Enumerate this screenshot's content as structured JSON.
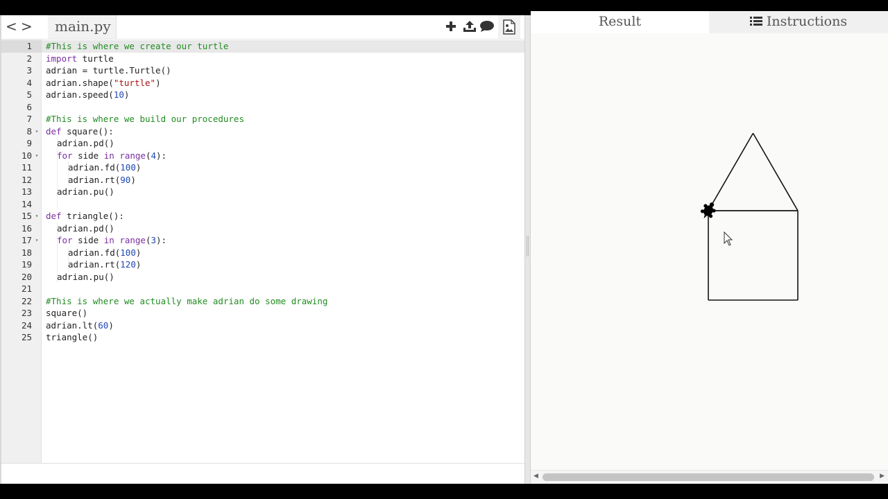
{
  "editor": {
    "nav_prev": "<",
    "nav_next": ">",
    "file_tab": "main.py",
    "toolbar": {
      "icons": [
        "plus-icon",
        "upload-icon",
        "comment-icon",
        "image-file-icon"
      ]
    },
    "lines": [
      {
        "n": "1",
        "fold": "",
        "indent": 0,
        "tokens": [
          {
            "t": "#This is where we create our turtle",
            "c": "com"
          }
        ]
      },
      {
        "n": "2",
        "fold": "",
        "indent": 0,
        "tokens": [
          {
            "t": "import",
            "c": "kw"
          },
          {
            "t": " turtle",
            "c": ""
          }
        ]
      },
      {
        "n": "3",
        "fold": "",
        "indent": 0,
        "tokens": [
          {
            "t": "adrian = turtle.Turtle()",
            "c": ""
          }
        ]
      },
      {
        "n": "4",
        "fold": "",
        "indent": 0,
        "tokens": [
          {
            "t": "adrian.shape(",
            "c": ""
          },
          {
            "t": "\"turtle\"",
            "c": "str"
          },
          {
            "t": ")",
            "c": ""
          }
        ]
      },
      {
        "n": "5",
        "fold": "",
        "indent": 0,
        "tokens": [
          {
            "t": "adrian.speed(",
            "c": ""
          },
          {
            "t": "10",
            "c": "num"
          },
          {
            "t": ")",
            "c": ""
          }
        ]
      },
      {
        "n": "6",
        "fold": "",
        "indent": 0,
        "tokens": []
      },
      {
        "n": "7",
        "fold": "",
        "indent": 0,
        "tokens": [
          {
            "t": "#This is where we build our procedures",
            "c": "com"
          }
        ]
      },
      {
        "n": "8",
        "fold": "▾",
        "indent": 0,
        "tokens": [
          {
            "t": "def",
            "c": "kw"
          },
          {
            "t": " square():",
            "c": ""
          }
        ]
      },
      {
        "n": "9",
        "fold": "",
        "indent": 1,
        "tokens": [
          {
            "t": "adrian.pd()",
            "c": ""
          }
        ]
      },
      {
        "n": "10",
        "fold": "▾",
        "indent": 1,
        "tokens": [
          {
            "t": "for",
            "c": "kw"
          },
          {
            "t": " side ",
            "c": ""
          },
          {
            "t": "in",
            "c": "kw"
          },
          {
            "t": " ",
            "c": ""
          },
          {
            "t": "range",
            "c": "kw"
          },
          {
            "t": "(",
            "c": ""
          },
          {
            "t": "4",
            "c": "num"
          },
          {
            "t": "):",
            "c": ""
          }
        ]
      },
      {
        "n": "11",
        "fold": "",
        "indent": 2,
        "tokens": [
          {
            "t": "adrian.fd(",
            "c": ""
          },
          {
            "t": "100",
            "c": "num"
          },
          {
            "t": ")",
            "c": ""
          }
        ]
      },
      {
        "n": "12",
        "fold": "",
        "indent": 2,
        "tokens": [
          {
            "t": "adrian.rt(",
            "c": ""
          },
          {
            "t": "90",
            "c": "num"
          },
          {
            "t": ")",
            "c": ""
          }
        ]
      },
      {
        "n": "13",
        "fold": "",
        "indent": 1,
        "tokens": [
          {
            "t": "adrian.pu()",
            "c": ""
          }
        ]
      },
      {
        "n": "14",
        "fold": "",
        "indent": 1,
        "tokens": []
      },
      {
        "n": "15",
        "fold": "▾",
        "indent": 0,
        "tokens": [
          {
            "t": "def",
            "c": "kw"
          },
          {
            "t": " triangle():",
            "c": ""
          }
        ]
      },
      {
        "n": "16",
        "fold": "",
        "indent": 1,
        "tokens": [
          {
            "t": "adrian.pd()",
            "c": ""
          }
        ]
      },
      {
        "n": "17",
        "fold": "▾",
        "indent": 1,
        "tokens": [
          {
            "t": "for",
            "c": "kw"
          },
          {
            "t": " side ",
            "c": ""
          },
          {
            "t": "in",
            "c": "kw"
          },
          {
            "t": " ",
            "c": ""
          },
          {
            "t": "range",
            "c": "kw"
          },
          {
            "t": "(",
            "c": ""
          },
          {
            "t": "3",
            "c": "num"
          },
          {
            "t": "):",
            "c": ""
          }
        ]
      },
      {
        "n": "18",
        "fold": "",
        "indent": 2,
        "tokens": [
          {
            "t": "adrian.fd(",
            "c": ""
          },
          {
            "t": "100",
            "c": "num"
          },
          {
            "t": ")",
            "c": ""
          }
        ]
      },
      {
        "n": "19",
        "fold": "",
        "indent": 2,
        "tokens": [
          {
            "t": "adrian.rt(",
            "c": ""
          },
          {
            "t": "120",
            "c": "num"
          },
          {
            "t": ")",
            "c": ""
          }
        ]
      },
      {
        "n": "20",
        "fold": "",
        "indent": 1,
        "tokens": [
          {
            "t": "adrian.pu()",
            "c": ""
          }
        ]
      },
      {
        "n": "21",
        "fold": "",
        "indent": 0,
        "tokens": []
      },
      {
        "n": "22",
        "fold": "",
        "indent": 0,
        "tokens": [
          {
            "t": "#This is where we actually make adrian do some drawing",
            "c": "com"
          }
        ]
      },
      {
        "n": "23",
        "fold": "",
        "indent": 0,
        "tokens": [
          {
            "t": "square()",
            "c": ""
          }
        ]
      },
      {
        "n": "24",
        "fold": "",
        "indent": 0,
        "tokens": [
          {
            "t": "adrian.lt(",
            "c": ""
          },
          {
            "t": "60",
            "c": "num"
          },
          {
            "t": ")",
            "c": ""
          }
        ]
      },
      {
        "n": "25",
        "fold": "",
        "indent": 0,
        "tokens": [
          {
            "t": "triangle()",
            "c": ""
          }
        ]
      }
    ]
  },
  "result": {
    "tab_result": "Result",
    "tab_instructions": "Instructions",
    "drawing": {
      "side_length": 100,
      "square_turn": 90,
      "left_turn": 60,
      "triangle_turn": 120,
      "line_color": "#111111",
      "turtle_color": "#000000"
    }
  },
  "colors": {
    "comment": "#228b22",
    "keyword": "#7a2ea0",
    "string": "#aa1111",
    "number": "#1c47b8"
  }
}
